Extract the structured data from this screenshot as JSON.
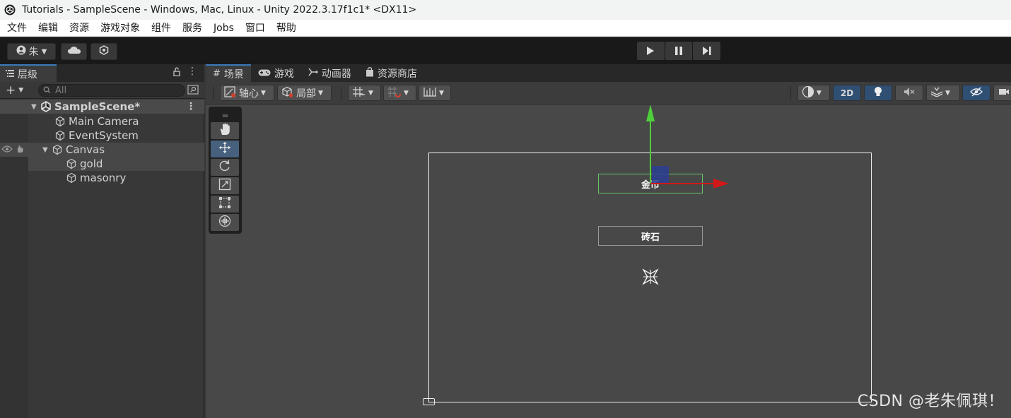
{
  "window": {
    "title": "Tutorials - SampleScene - Windows, Mac, Linux - Unity 2022.3.17f1c1* <DX11>"
  },
  "menu": {
    "items": [
      "文件",
      "编辑",
      "资源",
      "游戏对象",
      "组件",
      "服务",
      "Jobs",
      "窗口",
      "帮助"
    ]
  },
  "toolbar": {
    "account_label": "朱"
  },
  "hierarchy": {
    "tab_label": "层级",
    "search_placeholder": "All",
    "scene_name": "SampleScene*",
    "items": [
      {
        "label": "Main Camera",
        "depth": 1
      },
      {
        "label": "EventSystem",
        "depth": 1
      },
      {
        "label": "Canvas",
        "depth": 1,
        "expanded": true
      },
      {
        "label": "gold",
        "depth": 2
      },
      {
        "label": "masonry",
        "depth": 2
      }
    ]
  },
  "scene_tabs": [
    {
      "label": "场景",
      "icon": "grid-icon",
      "active": true
    },
    {
      "label": "游戏",
      "icon": "gamepad-icon"
    },
    {
      "label": "动画器",
      "icon": "animator-icon"
    },
    {
      "label": "资源商店",
      "icon": "store-bag-icon"
    }
  ],
  "scene_toolbar": {
    "pivot_label": "轴心",
    "local_label": "局部",
    "mode_2d_label": "2D"
  },
  "scene": {
    "gold_text": "金币",
    "masonry_text": "砖石"
  },
  "watermark": "CSDN @老朱佩琪！",
  "colors": {
    "accent": "#3a79bb",
    "gizmo_x": "#d21818",
    "gizmo_y": "#4ed03a",
    "selection": "#67c867"
  }
}
